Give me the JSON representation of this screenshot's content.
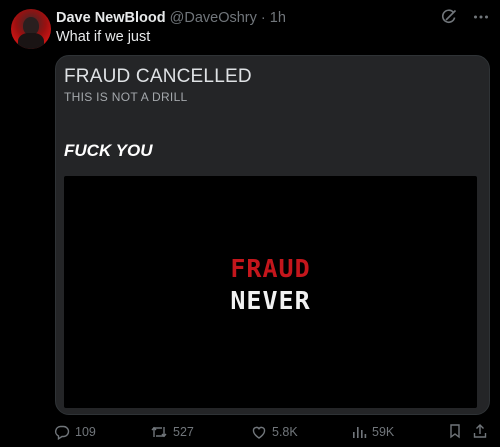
{
  "tweet": {
    "author_name": "Dave NewBlood",
    "handle": "@DaveOshry",
    "separator": "·",
    "time": "1h",
    "text": "What if we just"
  },
  "card": {
    "title": "FRAUD CANCELLED",
    "subtitle": "THIS IS NOT A DRILL",
    "bold_text": "FUCK YOU",
    "video": {
      "line1": "FRAUD",
      "line2": "NEVER"
    }
  },
  "stats": {
    "replies": "109",
    "reposts": "527",
    "likes": "5.8K",
    "views": "59K"
  },
  "colors": {
    "background": "#000000",
    "card": "#242527",
    "muted": "#71767b",
    "red_text": "#c4161c"
  },
  "icons": [
    "grok-icon",
    "more-icon",
    "reply-icon",
    "repost-icon",
    "like-icon",
    "views-icon",
    "bookmark-icon",
    "share-icon"
  ]
}
